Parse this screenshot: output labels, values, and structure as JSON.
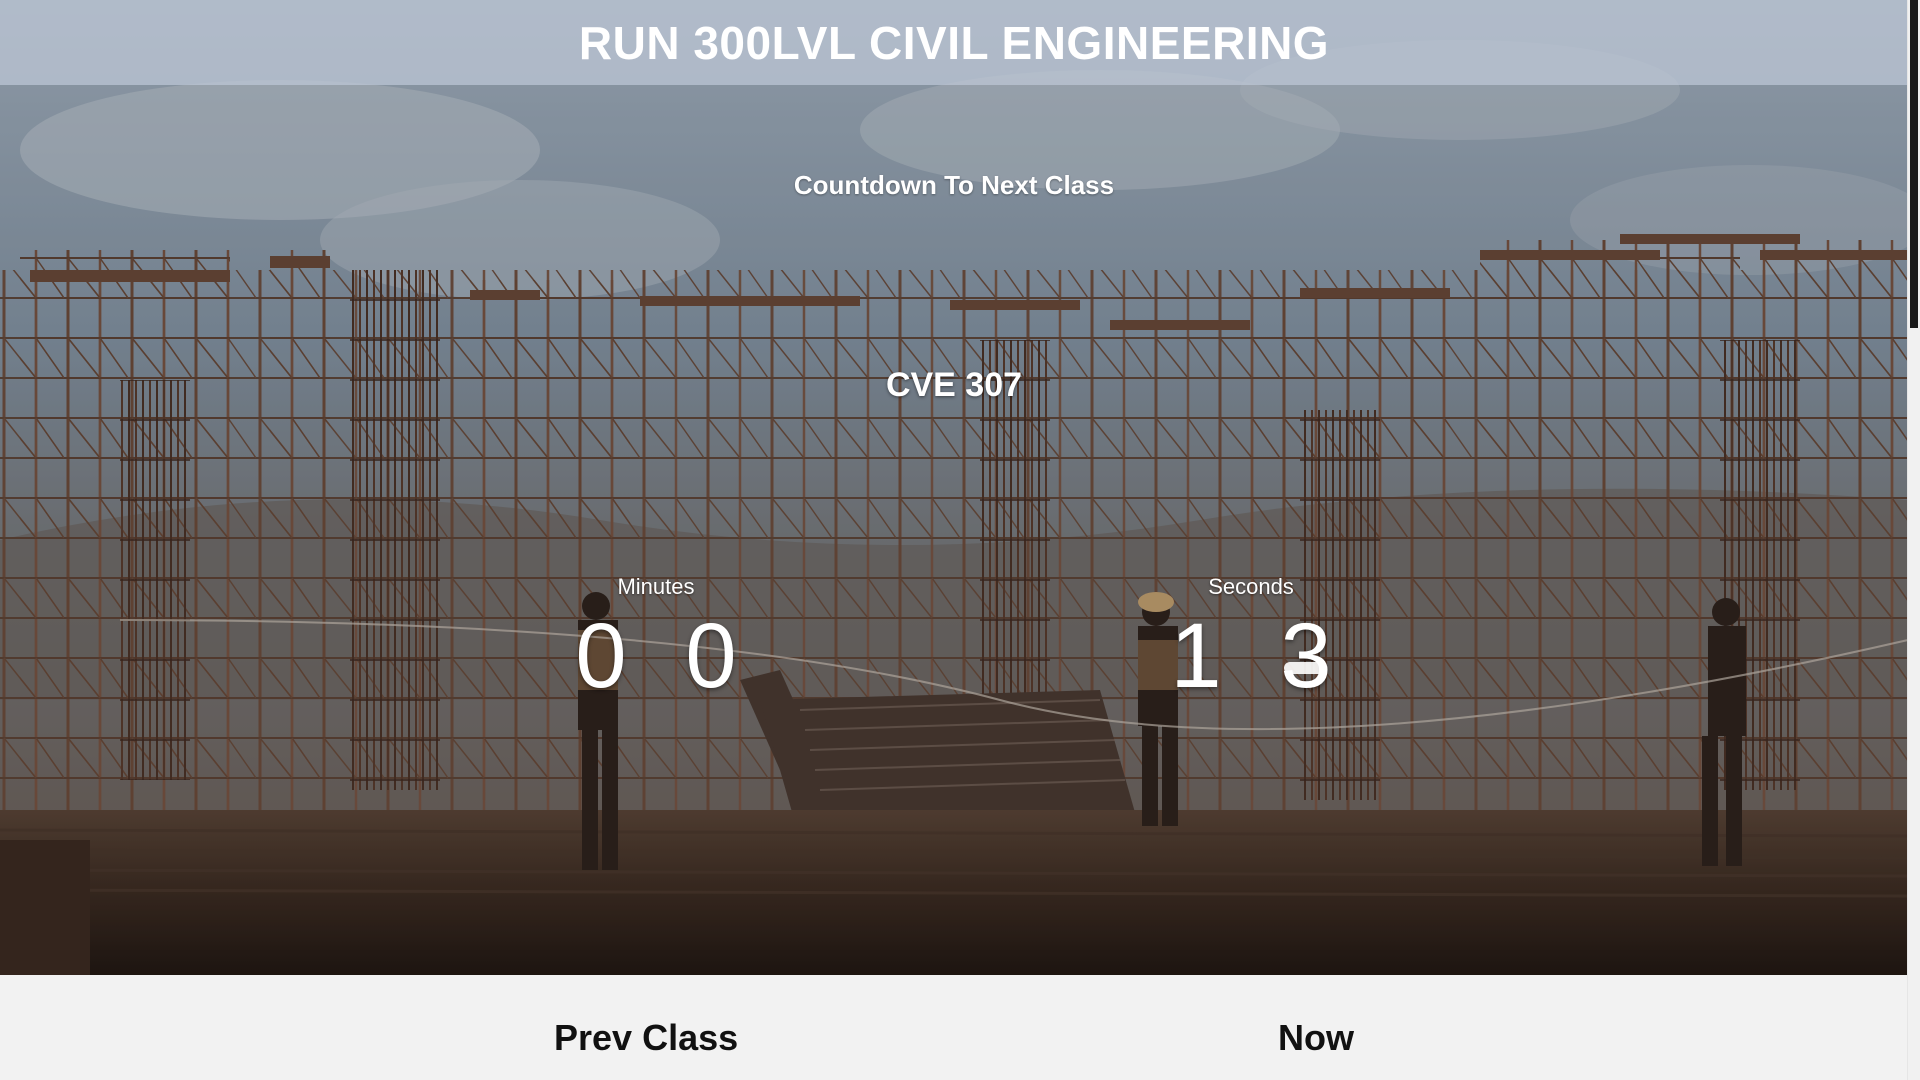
{
  "header": {
    "title": "RUN 300LVL CIVIL ENGINEERING"
  },
  "countdown": {
    "heading": "Countdown To Next Class",
    "course_code": "CVE 307",
    "minutes": {
      "label": "Minutes",
      "digits": [
        "0",
        "0"
      ]
    },
    "seconds": {
      "label": "Seconds",
      "digits": [
        "1",
        "3"
      ]
    }
  },
  "schedule": {
    "prev_label": "Prev Class",
    "now_label": "Now"
  },
  "background": {
    "description_icon": "construction-site-photo"
  },
  "colors": {
    "header_overlay": "#bec8d7",
    "text_light": "#ffffff",
    "text_dark": "#111111",
    "page_bg": "#f2f2f2",
    "scroll_thumb": "#1a1a1a"
  }
}
